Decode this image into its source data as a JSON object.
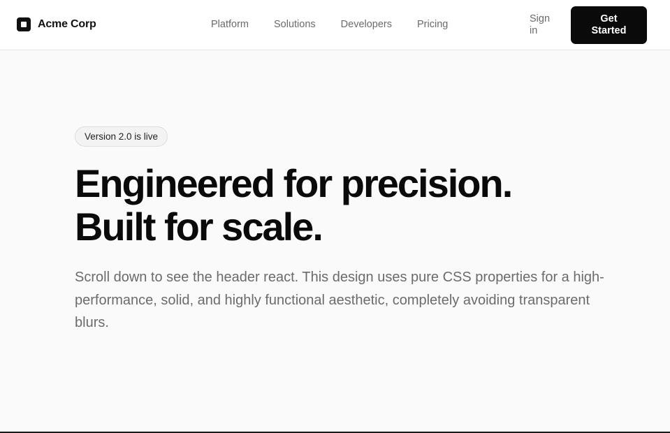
{
  "header": {
    "brand": "Acme Corp",
    "nav": [
      "Platform",
      "Solutions",
      "Developers",
      "Pricing"
    ],
    "sign_in": "Sign in",
    "cta": "Get Started"
  },
  "hero": {
    "badge": "Version 2.0 is live",
    "headline_line1": "Engineered for precision.",
    "headline_line2": "Built for scale.",
    "subtext": "Scroll down to see the header react. This design uses pure CSS properties for a high-performance, solid, and highly functional aesthetic, completely avoiding transparent blurs."
  }
}
